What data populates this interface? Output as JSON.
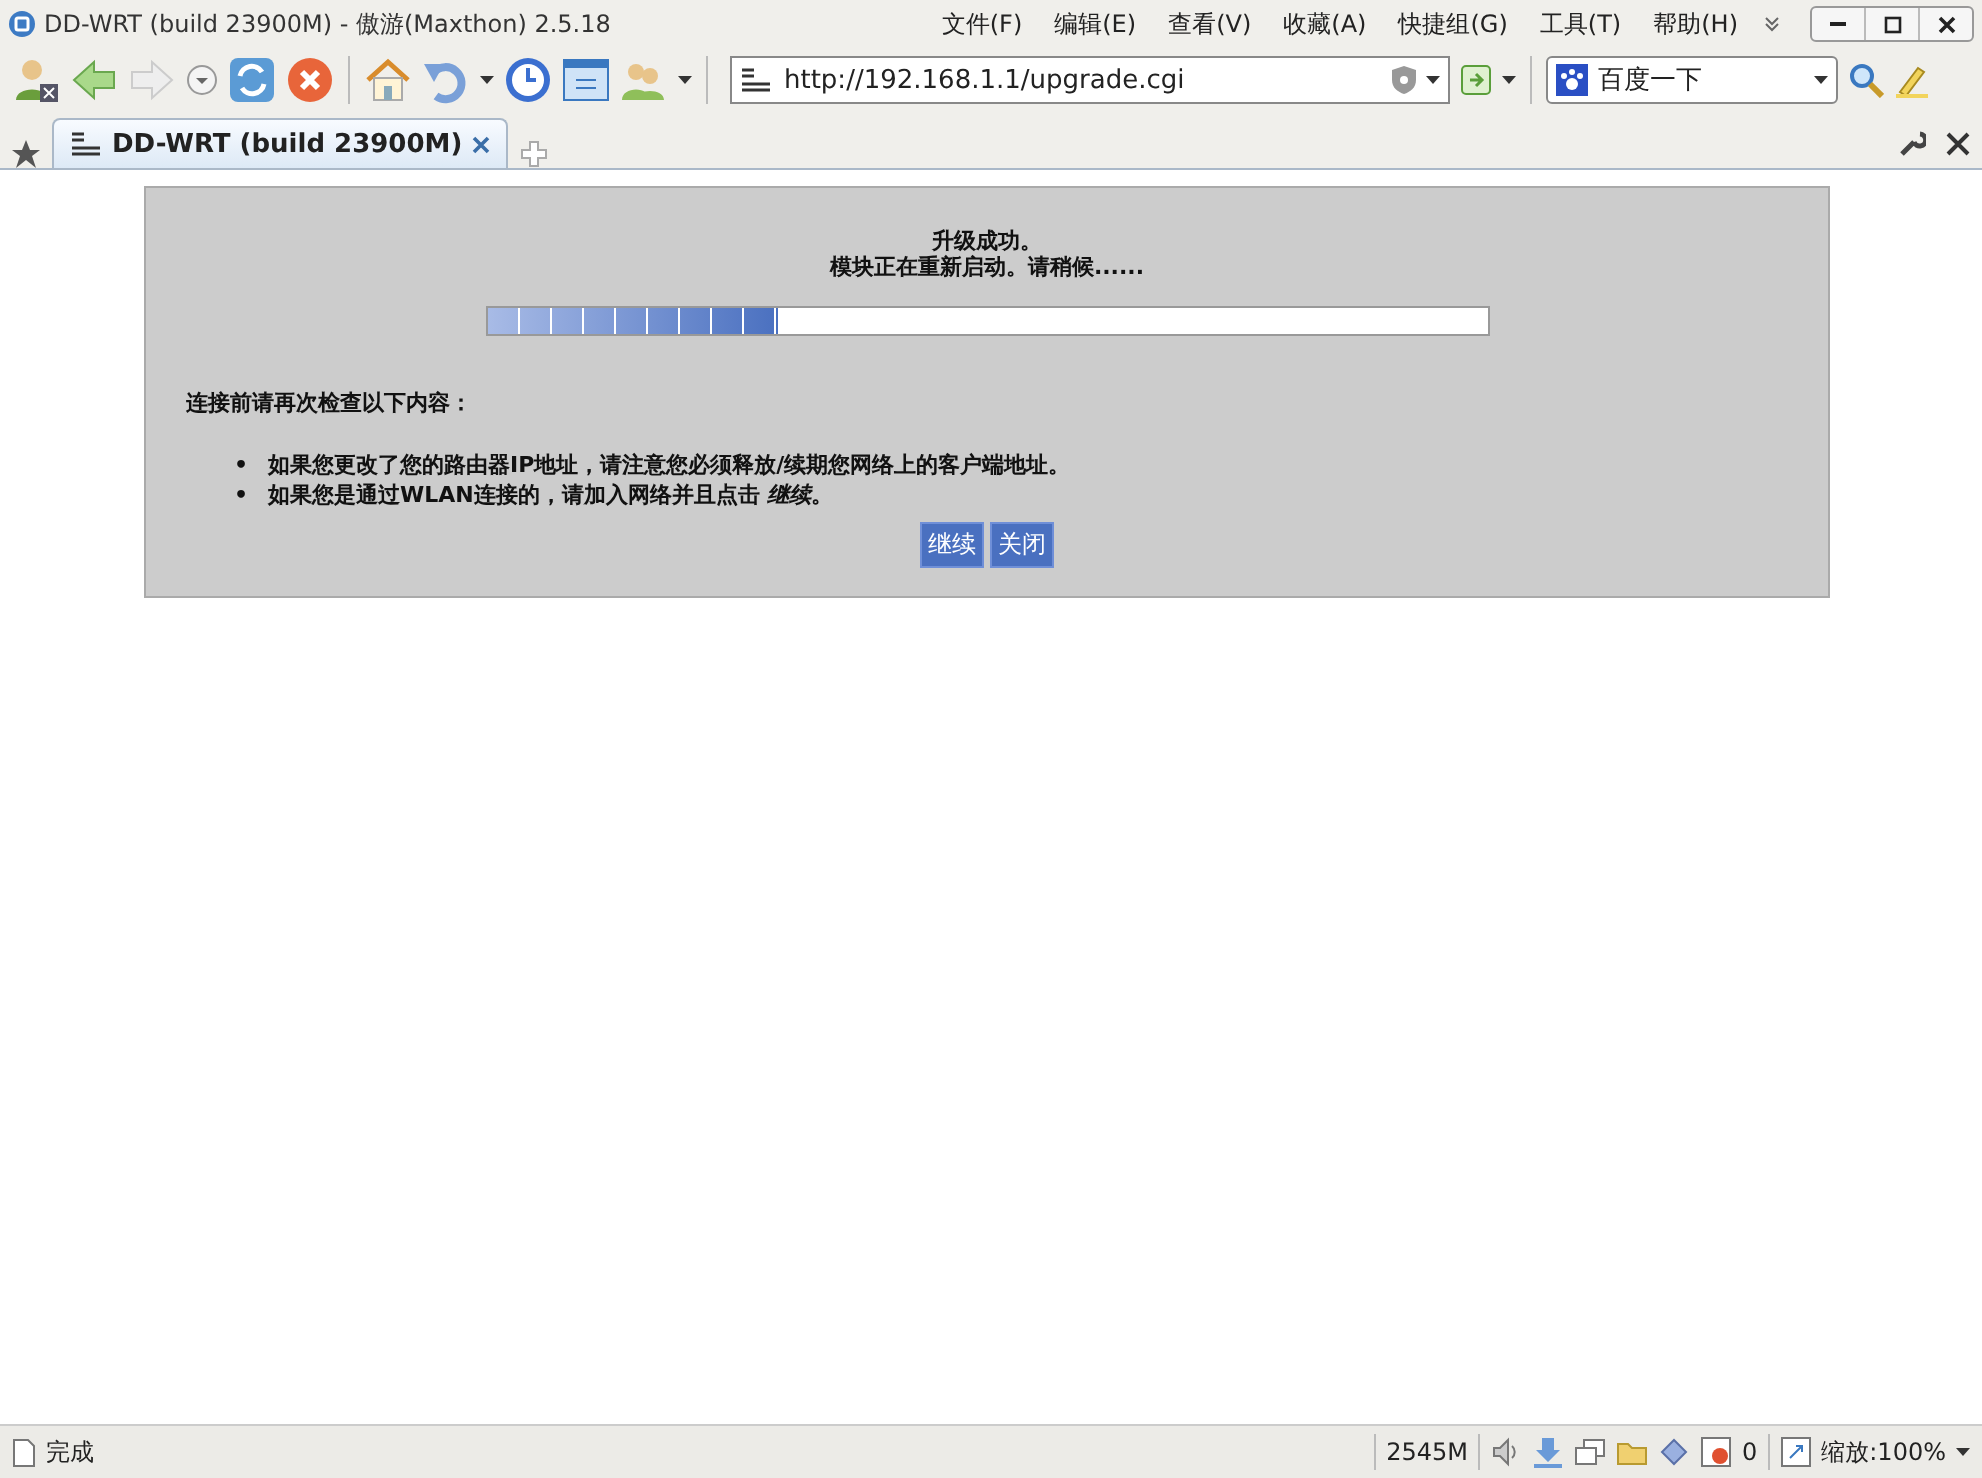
{
  "window": {
    "title": "DD-WRT (build 23900M) - 傲游(Maxthon) 2.5.18"
  },
  "menu": [
    "文件(F)",
    "编辑(E)",
    "查看(V)",
    "收藏(A)",
    "快捷组(G)",
    "工具(T)",
    "帮助(H)"
  ],
  "address_bar": {
    "value": "http://192.168.1.1/upgrade.cgi"
  },
  "search": {
    "value": "百度一下"
  },
  "tabs": [
    {
      "label": "DD-WRT (build 23900M)",
      "selected": true
    }
  ],
  "page": {
    "heading": "升级成功。",
    "message": "模块正在重新启动。请稍候......",
    "progress": {
      "level": 0.29
    },
    "check_title": "连接前请再次检查以下内容：",
    "items": [
      {
        "bullet": "•",
        "text": "如果您更改了您的路由器IP地址，请注意您必须释放/续期您网络上的客户端地址。"
      },
      {
        "bullet": "•",
        "text": "如果您是通过WLAN连接的，请加入网络并且点击 *继续*。"
      }
    ],
    "buttons": [
      "继续",
      "关闭"
    ]
  },
  "status_bar": {
    "status": "完成",
    "memory": "2545M",
    "count": "0",
    "zoom": "缩放:100%"
  }
}
